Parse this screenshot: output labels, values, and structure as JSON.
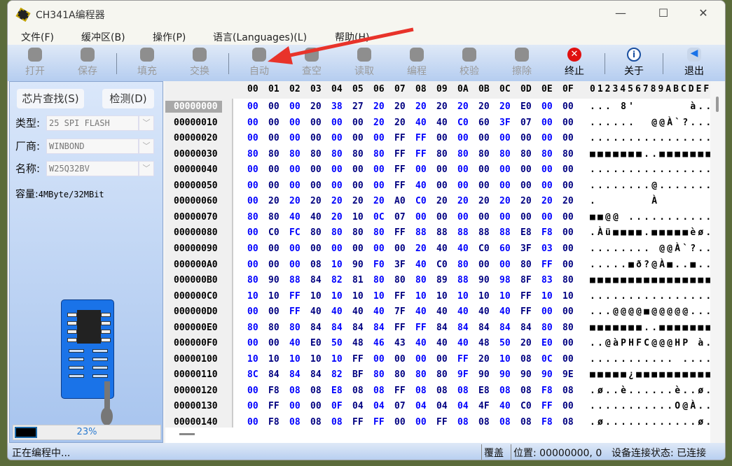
{
  "window": {
    "title": "CH341A编程器",
    "minimize": "—",
    "maximize": "☐",
    "close": "✕"
  },
  "menu": [
    "文件(F)",
    "缓冲区(B)",
    "操作(P)",
    "语言(Languages)(L)",
    "帮助(H)"
  ],
  "toolbar": [
    {
      "label": "打开",
      "icon": "open-icon",
      "enabled": false
    },
    {
      "label": "保存",
      "icon": "save-icon",
      "enabled": false
    },
    {
      "label": "填充",
      "icon": "fill-icon",
      "enabled": false
    },
    {
      "label": "交换",
      "icon": "swap-icon",
      "enabled": false
    },
    {
      "label": "自动",
      "icon": "auto-icon",
      "enabled": false
    },
    {
      "label": "查空",
      "icon": "blank-check-icon",
      "enabled": false
    },
    {
      "label": "读取",
      "icon": "read-icon",
      "enabled": false
    },
    {
      "label": "编程",
      "icon": "program-icon",
      "enabled": false
    },
    {
      "label": "校验",
      "icon": "verify-icon",
      "enabled": false
    },
    {
      "label": "擦除",
      "icon": "erase-icon",
      "enabled": false
    },
    {
      "label": "终止",
      "icon": "stop-icon",
      "enabled": true
    },
    {
      "label": "关于",
      "icon": "info-icon",
      "enabled": true
    },
    {
      "label": "退出",
      "icon": "exit-icon",
      "enabled": true
    }
  ],
  "left": {
    "find_chip": "芯片查找(S)",
    "detect": "检测(D)",
    "type_label": "类型:",
    "type_value": "25 SPI FLASH",
    "vendor_label": "厂商:",
    "vendor_value": "WINBOND",
    "name_label": "名称:",
    "name_value": "W25Q32BV",
    "capacity_label": "容量:",
    "capacity_value": "4MByte/32MBit",
    "progress_percent": 23,
    "progress_text": "23%"
  },
  "hex": {
    "columns": [
      "00",
      "01",
      "02",
      "03",
      "04",
      "05",
      "06",
      "07",
      "08",
      "09",
      "0A",
      "0B",
      "0C",
      "0D",
      "0E",
      "0F"
    ],
    "ascii_header": "0123456789ABCDEF",
    "even_color": "#0000ff",
    "odd_color": "#000080",
    "rows": [
      {
        "addr": "00000000",
        "bytes": "00 00 00 20 38 27 20 20 20 20 20 20 20 E0 00 00",
        "ascii": "... 8'       à.."
      },
      {
        "addr": "00000010",
        "bytes": "00 00 00 00 00 00 20 20 40 40 C0 60 3F 07 00 00",
        "ascii": "......  @@À`?..."
      },
      {
        "addr": "00000020",
        "bytes": "00 00 00 00 00 00 00 FF FF 00 00 00 00 00 00 00",
        "ascii": "................"
      },
      {
        "addr": "00000030",
        "bytes": "80 80 80 80 80 80 80 FF FF 80 80 80 80 80 80 80",
        "ascii": "■■■■■■■..■■■■■■■"
      },
      {
        "addr": "00000040",
        "bytes": "00 00 00 00 00 00 00 FF 00 00 00 00 00 00 00 00",
        "ascii": "................"
      },
      {
        "addr": "00000050",
        "bytes": "00 00 00 00 00 00 00 FF 40 00 00 00 00 00 00 00",
        "ascii": "........@......."
      },
      {
        "addr": "00000060",
        "bytes": "00 20 20 20 20 20 20 A0 C0 20 20 20 20 20 20 20",
        "ascii": ".       À       "
      },
      {
        "addr": "00000070",
        "bytes": "80 80 40 40 20 10 0C 07 00 00 00 00 00 00 00 00",
        "ascii": "■■@@ ..........."
      },
      {
        "addr": "00000080",
        "bytes": "00 C0 FC 80 80 80 80 FF 88 88 88 88 88 E8 F8 00",
        "ascii": ".Àü■■■■.■■■■■èø."
      },
      {
        "addr": "00000090",
        "bytes": "00 00 00 00 00 00 00 00 20 40 40 C0 60 3F 03 00",
        "ascii": "........ @@À`?.."
      },
      {
        "addr": "000000A0",
        "bytes": "00 00 00 08 10 90 F0 3F 40 C0 80 00 00 80 FF 00",
        "ascii": ".....■ð?@À■..■.."
      },
      {
        "addr": "000000B0",
        "bytes": "80 90 88 84 82 81 80 80 80 89 88 90 98 8F 83 80",
        "ascii": "■■■■■■■■■■■■■■■■"
      },
      {
        "addr": "000000C0",
        "bytes": "10 10 FF 10 10 10 10 FF 10 10 10 10 10 FF 10 10",
        "ascii": "................"
      },
      {
        "addr": "000000D0",
        "bytes": "00 00 FF 40 40 40 40 7F 40 40 40 40 40 FF 00 00",
        "ascii": "...@@@@■@@@@@..."
      },
      {
        "addr": "000000E0",
        "bytes": "80 80 80 84 84 84 84 FF FF 84 84 84 84 84 80 80",
        "ascii": "■■■■■■■..■■■■■■■"
      },
      {
        "addr": "000000F0",
        "bytes": "00 00 40 E0 50 48 46 43 40 40 40 48 50 20 E0 00",
        "ascii": "..@àPHFC@@@HP à."
      },
      {
        "addr": "00000100",
        "bytes": "10 10 10 10 10 FF 00 00 00 00 FF 20 10 08 0C 00",
        "ascii": "........... ...."
      },
      {
        "addr": "00000110",
        "bytes": "8C 84 84 84 82 BF 80 80 80 80 9F 90 90 90 90 9E",
        "ascii": "■■■■■¿■■■■■■■■■■"
      },
      {
        "addr": "00000120",
        "bytes": "00 F8 08 08 E8 08 08 FF 08 08 08 E8 08 08 F8 08",
        "ascii": ".ø..è......è..ø."
      },
      {
        "addr": "00000130",
        "bytes": "00 FF 00 00 0F 04 04 07 04 04 04 4F 40 C0 FF 00",
        "ascii": "...........O@À.."
      },
      {
        "addr": "00000140",
        "bytes": "00 F8 08 08 08 FF FF 00 00 FF 08 08 08 08 F8 08",
        "ascii": ".ø............ø."
      }
    ]
  },
  "status": {
    "message": "正在编程中...",
    "mode": "覆盖",
    "position": "位置: 00000000, 0",
    "connection": "设备连接状态: 已连接"
  },
  "colors": {
    "annotation_arrow": "#e8332a",
    "toolbar_gradient_top": "#dfe9f7",
    "toolbar_gradient_bottom": "#b5cdf0"
  }
}
